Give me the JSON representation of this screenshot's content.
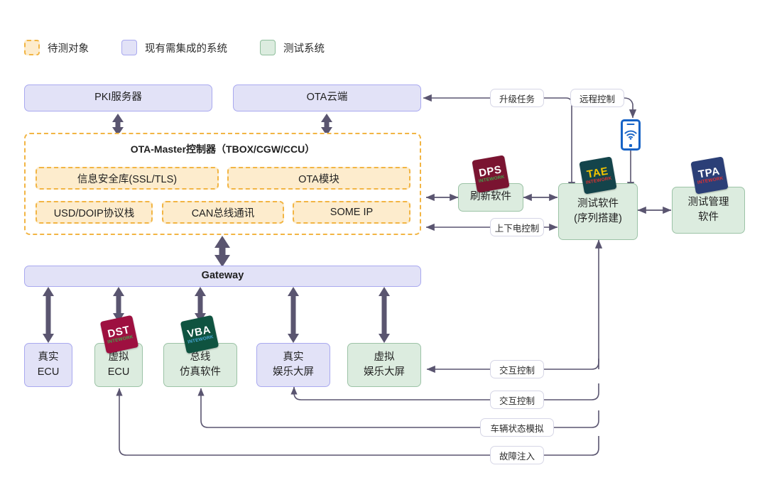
{
  "legend": [
    {
      "key": "dut",
      "label": "待测对象",
      "style": "dashed",
      "color": "#f2b544"
    },
    {
      "key": "existing",
      "label": "现有需集成的系统",
      "style": "purple",
      "color": "#a9a9ef"
    },
    {
      "key": "test",
      "label": "测试系统",
      "style": "green",
      "color": "#9cc3a6"
    }
  ],
  "nodes": {
    "pki": {
      "label": "PKI服务器"
    },
    "ota_cloud": {
      "label": "OTA云端"
    },
    "ota_master": {
      "title": "OTA-Master控制器（TBOX/CGW/CCU）"
    },
    "sec_lib": {
      "label": "信息安全库(SSL/TLS)"
    },
    "ota_module": {
      "label": "OTA模块"
    },
    "usd_doip": {
      "label": "USD/DOIP协议栈"
    },
    "can_bus": {
      "label": "CAN总线通讯"
    },
    "some_ip": {
      "label": "SOME IP"
    },
    "gateway": {
      "label": "Gateway"
    },
    "real_ecu": {
      "line1": "真实",
      "line2": "ECU"
    },
    "virtual_ecu": {
      "line1": "虚拟",
      "line2": "ECU"
    },
    "bus_sim": {
      "line1": "总线",
      "line2": "仿真软件"
    },
    "real_screen": {
      "line1": "真实",
      "line2": "娱乐大屏"
    },
    "virtual_screen": {
      "line1": "虚拟",
      "line2": "娱乐大屏"
    },
    "flash_sw": {
      "label": "刷新软件"
    },
    "test_sw": {
      "line1": "测试软件",
      "line2": "(序列搭建)"
    },
    "test_mgmt_sw": {
      "line1": "测试管理",
      "line2": "软件"
    }
  },
  "edge_labels": {
    "upgrade_task": "升级任务",
    "remote_control": "远程控制",
    "power_control": "上下电控制",
    "interaction_1": "交互控制",
    "interaction_2": "交互控制",
    "vehicle_state": "车辆状态模拟",
    "fault_injection": "故障注入"
  },
  "logos": [
    {
      "id": "dps",
      "l1": "DPS",
      "l2": "INTEWORK",
      "bg": "#7a1431",
      "c1": "#ffffff",
      "c2": "#3fa64b",
      "rot": -10
    },
    {
      "id": "tae",
      "l1": "TAE",
      "l2": "INTEWORK",
      "bg": "#14444b",
      "c1": "#f2c400",
      "c2": "#e03131",
      "rot": -10
    },
    {
      "id": "tpa",
      "l1": "TPA",
      "l2": "INTEWORK",
      "bg": "#2b3f77",
      "c1": "#ffffff",
      "c2": "#e03131",
      "rot": -10
    },
    {
      "id": "dst",
      "l1": "DST",
      "l2": "INTEWORK",
      "bg": "#9e1040",
      "c1": "#ffffff",
      "c2": "#3fa64b",
      "rot": -12
    },
    {
      "id": "vba",
      "l1": "VBA",
      "l2": "INTEWORK",
      "bg": "#0f5340",
      "c1": "#ffffff",
      "c2": "#4aa8d8",
      "rot": -12
    }
  ],
  "icons": {
    "phone": "wifi-phone-icon"
  },
  "colors": {
    "wire": "#5a5570",
    "purple_fill": "#e2e2f7",
    "purple_border": "#a9a9ef",
    "green_fill": "#dcecdf",
    "green_border": "#9cc3a6",
    "orange_fill": "#fdeccd",
    "orange_border": "#f2b544"
  }
}
